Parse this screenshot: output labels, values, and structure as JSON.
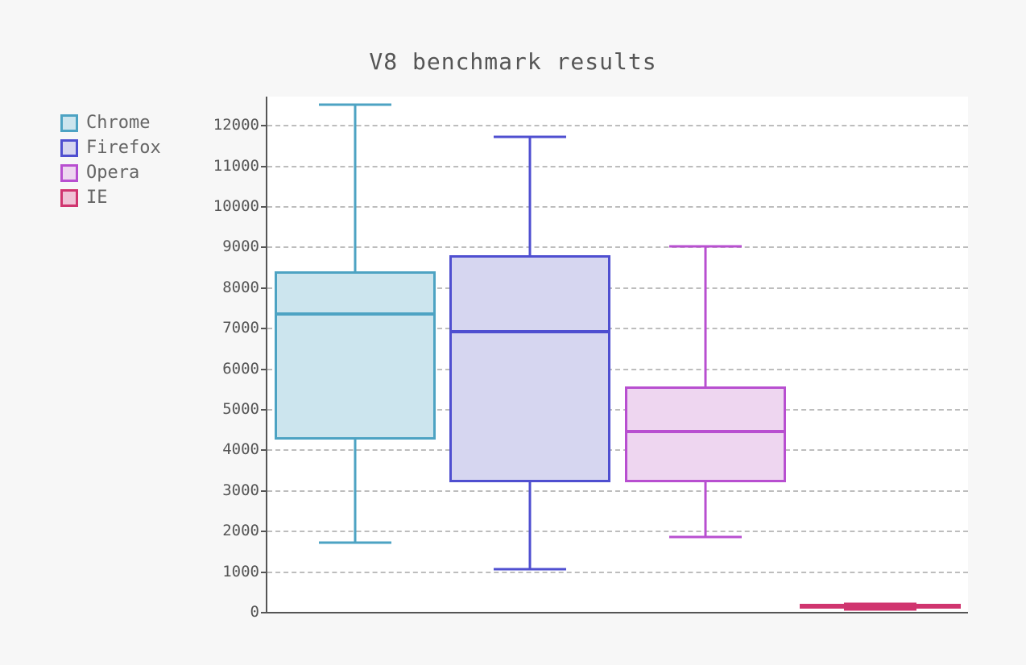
{
  "title": "V8 benchmark results",
  "legend": [
    {
      "label": "Chrome",
      "fill": "#cce5ee",
      "stroke": "#4da3c3"
    },
    {
      "label": "Firefox",
      "fill": "#d6d6f0",
      "stroke": "#4f4fd0"
    },
    {
      "label": "Opera",
      "fill": "#eed6f0",
      "stroke": "#b84fd0"
    },
    {
      "label": "IE",
      "fill": "#f0c3d6",
      "stroke": "#d0356f"
    }
  ],
  "y_ticks": [
    0,
    1000,
    2000,
    3000,
    4000,
    5000,
    6000,
    7000,
    8000,
    9000,
    10000,
    11000,
    12000
  ],
  "chart_data": {
    "type": "boxplot",
    "title": "V8 benchmark results",
    "xlabel": "",
    "ylabel": "",
    "ylim": [
      0,
      12700
    ],
    "grid": true,
    "legend_position": "left",
    "series": [
      {
        "name": "Chrome",
        "min": 1700,
        "q1": 4250,
        "median": 7350,
        "q3": 8400,
        "max": 12500,
        "color": "#4da3c3",
        "fill": "#cce5ee"
      },
      {
        "name": "Firefox",
        "min": 1050,
        "q1": 3200,
        "median": 6900,
        "q3": 8800,
        "max": 11700,
        "color": "#4f4fd0",
        "fill": "#d6d6f0"
      },
      {
        "name": "Opera",
        "min": 1850,
        "q1": 3200,
        "median": 4450,
        "q3": 5550,
        "max": 9000,
        "color": "#b84fd0",
        "fill": "#eed6f0"
      },
      {
        "name": "IE",
        "min": 60,
        "q1": 80,
        "median": 120,
        "q3": 180,
        "max": 200,
        "color": "#d0356f",
        "fill": "#f0c3d6"
      }
    ]
  }
}
